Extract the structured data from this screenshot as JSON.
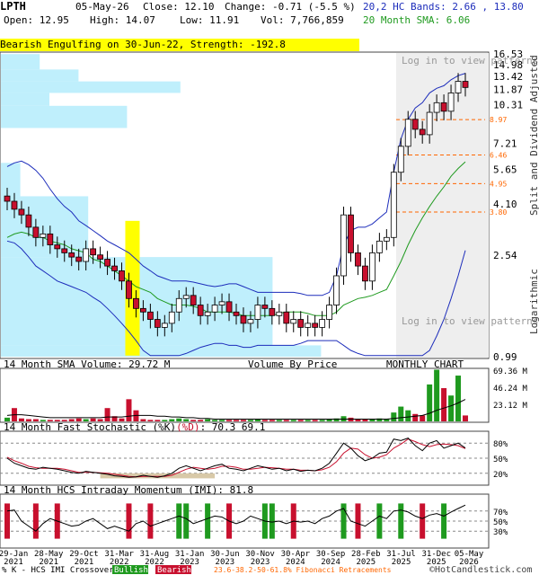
{
  "header": {
    "ticker": "LPTH",
    "date": "05-May-26",
    "close": "Close: 12.10",
    "change": "Change: -0.71 (-5.5 %)",
    "bands": "20,2 HC Bands: 2.66 , 13.80",
    "open": "Open: 12.95",
    "high": "High: 14.07",
    "low": "Low: 11.91",
    "vol": "Vol: 7,766,859",
    "sma": "20 Month SMA: 6.06"
  },
  "signal": "Bearish Engulfing on 30-Jun-22, Strength: -192.8",
  "overlay_text": "Log in to view patterns in this area",
  "price_axis_labels": [
    "16.53",
    "14.98",
    "13.42",
    "11.87",
    "10.31",
    "8.97",
    "7.21",
    "6.46",
    "5.65",
    "4.95",
    "4.10",
    "3.80",
    "2.54",
    "0.99"
  ],
  "fib_labels": [
    "8.97",
    "6.46",
    "4.95",
    "3.80"
  ],
  "right_titles": {
    "adjusted": "Split and Dividend Adjusted",
    "scale": "Logarithmic"
  },
  "panel_titles": {
    "volume": "14 Month SMA Volume: 29.72 M",
    "vbp": "Volume By Price",
    "monthly": "MONTHLY CHART",
    "stoch": "14 Month Fast Stochastic (%K)",
    "stoch_d": "(%D)",
    "stoch_vals": ": 70.3  69.1",
    "imi": "14 Month HCS Intraday Momentum (IMI): 81.8"
  },
  "volume_axis_labels": [
    "69.36 M",
    "46.24 M",
    "23.12 M"
  ],
  "stoch_axis_labels": [
    "80%",
    "50%",
    "20%"
  ],
  "imi_axis_labels": [
    "70%",
    "50%",
    "30%"
  ],
  "x_axis_labels": [
    {
      "top": "29-Jan",
      "bottom": "2021"
    },
    {
      "top": "28-May",
      "bottom": "2021"
    },
    {
      "top": "29-Oct",
      "bottom": "2021"
    },
    {
      "top": "31-Mar",
      "bottom": "2022"
    },
    {
      "top": "31-Aug",
      "bottom": "2022"
    },
    {
      "top": "31-Jan",
      "bottom": "2023"
    },
    {
      "top": "30-Jun",
      "bottom": "2023"
    },
    {
      "top": "30-Nov",
      "bottom": "2023"
    },
    {
      "top": "30-Apr",
      "bottom": "2024"
    },
    {
      "top": "30-Sep",
      "bottom": "2024"
    },
    {
      "top": "28-Feb",
      "bottom": "2025"
    },
    {
      "top": "31-Jul",
      "bottom": "2025"
    },
    {
      "top": "31-Dec",
      "bottom": "2025"
    },
    {
      "top": "05-May",
      "bottom": "2026"
    }
  ],
  "footer": {
    "legend_prefix": "% K - HCS IMI Crossover:",
    "bullish": "Bullish",
    "bearish": "Bearish",
    "fib": "23.6-38.2-50-61.8% Fibonacci Retracements",
    "copyright": "©HotCandlestick.com"
  },
  "colors": {
    "up": "#ffffff",
    "down": "#c8102e",
    "upper_band": "#1d2dbb",
    "sma": "#1f9a1f",
    "highlight": "#ffff00",
    "vbp": "#bfeffc",
    "fib": "#ff6600",
    "overlay": "#eeeeee"
  },
  "chart_data": {
    "type": "candlestick",
    "scale": "log",
    "ylim": [
      0.99,
      16.53
    ],
    "x": [
      "Jan-21",
      "Feb-21",
      "Mar-21",
      "Apr-21",
      "May-21",
      "Jun-21",
      "Jul-21",
      "Aug-21",
      "Sep-21",
      "Oct-21",
      "Nov-21",
      "Dec-21",
      "Jan-22",
      "Feb-22",
      "Mar-22",
      "Apr-22",
      "May-22",
      "Jun-22",
      "Jul-22",
      "Aug-22",
      "Sep-22",
      "Oct-22",
      "Nov-22",
      "Dec-22",
      "Jan-23",
      "Feb-23",
      "Mar-23",
      "Apr-23",
      "May-23",
      "Jun-23",
      "Jul-23",
      "Aug-23",
      "Sep-23",
      "Oct-23",
      "Nov-23",
      "Dec-23",
      "Jan-24",
      "Feb-24",
      "Mar-24",
      "Apr-24",
      "May-24",
      "Jun-24",
      "Jul-24",
      "Aug-24",
      "Sep-24",
      "Oct-24",
      "Nov-24",
      "Dec-24",
      "Jan-25",
      "Feb-25",
      "Mar-25",
      "Apr-25",
      "May-25",
      "Jun-25",
      "Jul-25",
      "Aug-25",
      "Sep-25",
      "Oct-25",
      "Nov-25",
      "Dec-25",
      "Jan-26",
      "Feb-26",
      "Mar-26",
      "Apr-26",
      "May-26"
    ],
    "close": [
      4.2,
      3.9,
      3.7,
      3.3,
      3.0,
      3.1,
      2.8,
      2.7,
      2.6,
      2.5,
      2.4,
      2.7,
      2.55,
      2.45,
      2.3,
      2.2,
      2.0,
      1.7,
      1.55,
      1.5,
      1.4,
      1.3,
      1.35,
      1.5,
      1.7,
      1.75,
      1.6,
      1.45,
      1.5,
      1.6,
      1.65,
      1.5,
      1.45,
      1.35,
      1.4,
      1.6,
      1.55,
      1.45,
      1.5,
      1.35,
      1.4,
      1.3,
      1.35,
      1.3,
      1.4,
      1.6,
      2.1,
      3.7,
      2.6,
      2.3,
      2.0,
      2.6,
      2.9,
      3.0,
      5.5,
      7.0,
      9.0,
      8.2,
      7.8,
      9.6,
      10.5,
      9.7,
      11.5,
      12.81,
      12.1
    ],
    "sma20": [
      3.0,
      3.1,
      3.15,
      3.1,
      3.0,
      3.0,
      2.9,
      2.85,
      2.8,
      2.7,
      2.65,
      2.6,
      2.45,
      2.4,
      2.3,
      2.2,
      2.1,
      2.0,
      1.9,
      1.85,
      1.8,
      1.7,
      1.65,
      1.6,
      1.6,
      1.6,
      1.58,
      1.55,
      1.5,
      1.5,
      1.5,
      1.5,
      1.48,
      1.45,
      1.45,
      1.45,
      1.45,
      1.45,
      1.48,
      1.5,
      1.5,
      1.5,
      1.48,
      1.45,
      1.45,
      1.45,
      1.5,
      1.6,
      1.65,
      1.7,
      1.72,
      1.75,
      1.8,
      1.85,
      2.1,
      2.4,
      2.8,
      3.2,
      3.6,
      4.0,
      4.4,
      4.8,
      5.3,
      5.7,
      6.06
    ],
    "upper_band": [
      5.8,
      6.0,
      6.1,
      5.9,
      5.6,
      5.2,
      4.7,
      4.3,
      4.0,
      3.8,
      3.5,
      3.35,
      3.2,
      3.05,
      2.9,
      2.8,
      2.7,
      2.6,
      2.45,
      2.3,
      2.2,
      2.1,
      2.05,
      2.0,
      2.0,
      2.0,
      1.98,
      1.95,
      1.92,
      1.9,
      1.92,
      1.95,
      1.95,
      1.9,
      1.85,
      1.8,
      1.8,
      1.8,
      1.8,
      1.8,
      1.8,
      1.78,
      1.75,
      1.75,
      1.75,
      1.8,
      2.1,
      2.8,
      3.2,
      3.3,
      3.3,
      3.4,
      3.6,
      3.8,
      5.5,
      7.5,
      9.0,
      10.0,
      10.5,
      11.5,
      12.0,
      12.3,
      13.0,
      13.5,
      13.8
    ],
    "lower_band": [
      2.9,
      2.85,
      2.7,
      2.5,
      2.3,
      2.2,
      2.1,
      2.0,
      1.95,
      1.9,
      1.85,
      1.8,
      1.72,
      1.65,
      1.55,
      1.45,
      1.35,
      1.25,
      1.15,
      1.05,
      1.0,
      1.0,
      1.0,
      1.0,
      1.0,
      1.02,
      1.05,
      1.08,
      1.1,
      1.12,
      1.12,
      1.1,
      1.1,
      1.08,
      1.08,
      1.1,
      1.1,
      1.1,
      1.1,
      1.1,
      1.1,
      1.12,
      1.15,
      1.15,
      1.15,
      1.15,
      1.15,
      1.1,
      1.05,
      1.02,
      1.0,
      1.0,
      1.0,
      1.0,
      1.0,
      1.0,
      1.0,
      1.0,
      1.0,
      1.05,
      1.2,
      1.4,
      1.7,
      2.1,
      2.66
    ],
    "fib_levels": [
      8.97,
      6.46,
      4.95,
      3.8
    ],
    "volume": [
      5,
      18,
      4,
      3,
      3,
      2,
      2,
      2,
      2,
      3,
      4,
      3,
      4,
      3,
      18,
      7,
      4,
      30,
      15,
      3,
      2,
      2,
      2,
      3,
      4,
      3,
      2,
      2,
      3,
      2,
      2,
      2,
      2,
      2,
      2,
      3,
      2,
      2,
      2,
      2,
      2,
      2,
      2,
      2,
      2,
      3,
      4,
      7,
      5,
      3,
      3,
      3,
      4,
      3,
      12,
      20,
      15,
      10,
      8,
      50,
      70,
      45,
      35,
      62,
      8
    ],
    "volume_sma": [
      8,
      9,
      9,
      8,
      7,
      6,
      5,
      5,
      5,
      5,
      5,
      5,
      5,
      5,
      6,
      6,
      6,
      7,
      8,
      8,
      8,
      7,
      7,
      6,
      6,
      5,
      5,
      4,
      4,
      3,
      3,
      3,
      3,
      3,
      3,
      3,
      3,
      3,
      3,
      3,
      3,
      3,
      3,
      3,
      3,
      3,
      3,
      3,
      3,
      3,
      3,
      3,
      3,
      3,
      4,
      5,
      6,
      7,
      8,
      11,
      15,
      18,
      21,
      25,
      29.72
    ],
    "stoch_k": [
      50,
      40,
      35,
      30,
      28,
      32,
      30,
      28,
      25,
      22,
      20,
      24,
      22,
      20,
      18,
      15,
      14,
      12,
      13,
      16,
      14,
      12,
      15,
      20,
      30,
      35,
      30,
      25,
      30,
      35,
      38,
      30,
      28,
      25,
      30,
      35,
      32,
      28,
      30,
      25,
      28,
      24,
      26,
      25,
      30,
      40,
      60,
      80,
      70,
      55,
      45,
      50,
      60,
      62,
      88,
      85,
      90,
      75,
      65,
      80,
      85,
      70,
      75,
      80,
      70.3
    ],
    "stoch_d": [
      52,
      45,
      40,
      34,
      31,
      30,
      30,
      30,
      28,
      25,
      22,
      22,
      22,
      21,
      20,
      18,
      16,
      14,
      13,
      14,
      14,
      14,
      14,
      16,
      22,
      28,
      32,
      30,
      28,
      30,
      34,
      34,
      32,
      28,
      28,
      30,
      32,
      31,
      30,
      28,
      28,
      26,
      26,
      25,
      27,
      32,
      43,
      60,
      70,
      68,
      57,
      50,
      52,
      57,
      70,
      78,
      88,
      83,
      77,
      73,
      77,
      78,
      77,
      75,
      69.1
    ],
    "imi": [
      70,
      72,
      50,
      40,
      30,
      45,
      55,
      50,
      45,
      40,
      42,
      50,
      55,
      45,
      35,
      40,
      35,
      30,
      45,
      50,
      40,
      45,
      50,
      55,
      60,
      55,
      45,
      50,
      55,
      60,
      58,
      50,
      45,
      50,
      60,
      55,
      50,
      48,
      50,
      45,
      50,
      48,
      50,
      45,
      55,
      60,
      70,
      75,
      50,
      45,
      40,
      50,
      60,
      55,
      70,
      72,
      68,
      60,
      55,
      62,
      65,
      60,
      68,
      75,
      81.8
    ],
    "markers": {
      "bullish": [
        24,
        25,
        28,
        36,
        37,
        47,
        52,
        55,
        61
      ],
      "bearish": [
        0,
        4,
        7,
        17,
        20,
        31,
        40,
        49,
        58
      ]
    },
    "vbp_bars": [
      {
        "from": 16.5,
        "to": 14.3,
        "strength": 0.08
      },
      {
        "from": 14.3,
        "to": 12.8,
        "strength": 0.16
      },
      {
        "from": 12.8,
        "to": 11.5,
        "strength": 0.37
      },
      {
        "from": 11.5,
        "to": 10.2,
        "strength": 0.1
      },
      {
        "from": 10.2,
        "to": 8.3,
        "strength": 0.26
      },
      {
        "from": 6.0,
        "to": 4.4,
        "strength": 0.04
      },
      {
        "from": 4.4,
        "to": 2.5,
        "strength": 0.18
      },
      {
        "from": 2.5,
        "to": 1.1,
        "strength": 0.56
      },
      {
        "from": 1.1,
        "to": 0.99,
        "strength": 0.66
      }
    ]
  }
}
